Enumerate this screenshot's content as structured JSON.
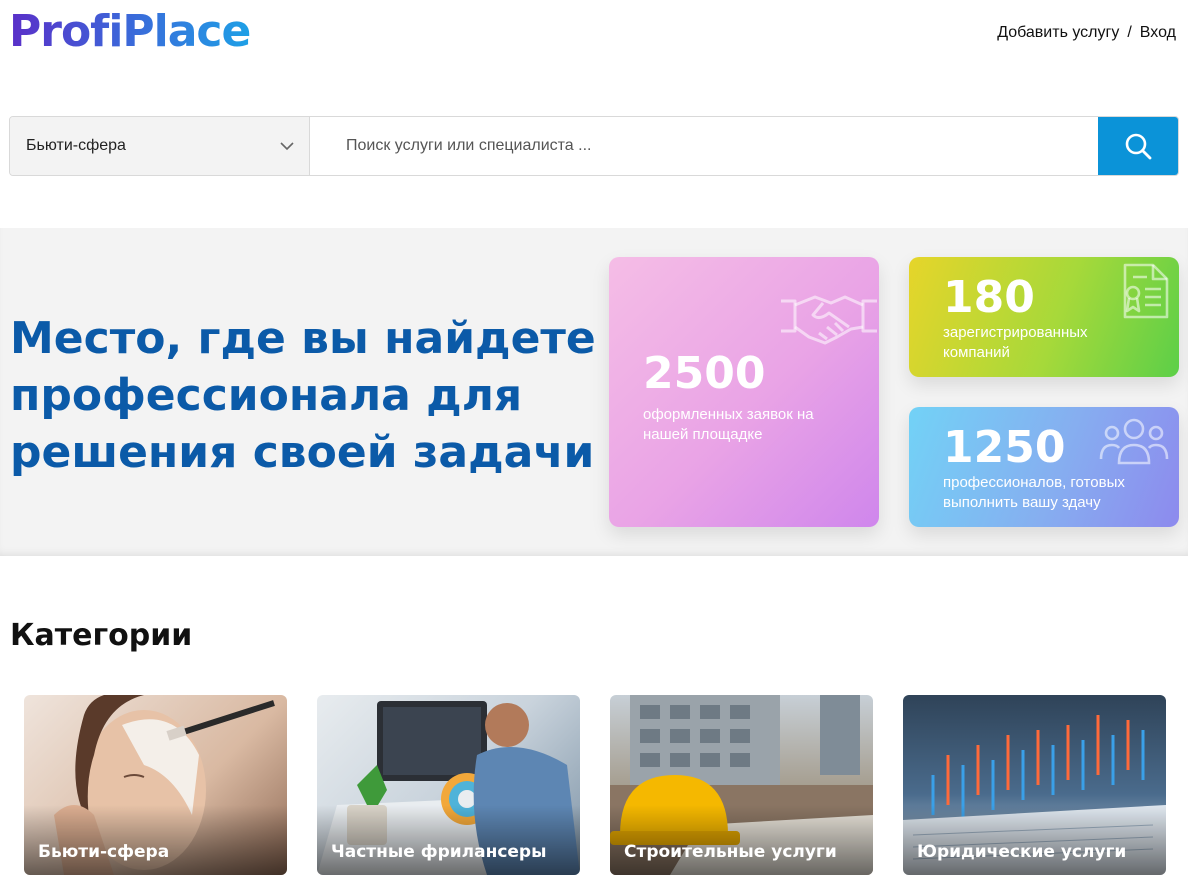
{
  "header": {
    "logo": "ProfiPlace",
    "links": {
      "add_service": "Добавить услугу",
      "separator": "/",
      "login": "Вход"
    }
  },
  "search": {
    "category_selected": "Бьюти-сфера",
    "placeholder": "Поиск услуги или специалиста ..."
  },
  "hero": {
    "title": "Место, где вы найдете профессионала для решения своей задачи",
    "stats": [
      {
        "value": "2500",
        "label": "оформленных заявок на нашей площадке",
        "icon": "handshake-icon"
      },
      {
        "value": "180",
        "label": "зарегистрированных компаний",
        "icon": "certificate-icon"
      },
      {
        "value": "1250",
        "label": "профессионалов, готовых выполнить вашу здачу",
        "icon": "users-icon"
      }
    ]
  },
  "categories": {
    "title": "Категории",
    "items": [
      {
        "label": "Бьюти-сфера"
      },
      {
        "label": "Частные фрилансеры"
      },
      {
        "label": "Строительные услуги"
      },
      {
        "label": "Юридические услуги"
      }
    ]
  },
  "colors": {
    "brand_blue": "#0b5aa8",
    "search_button": "#0b93d8"
  }
}
